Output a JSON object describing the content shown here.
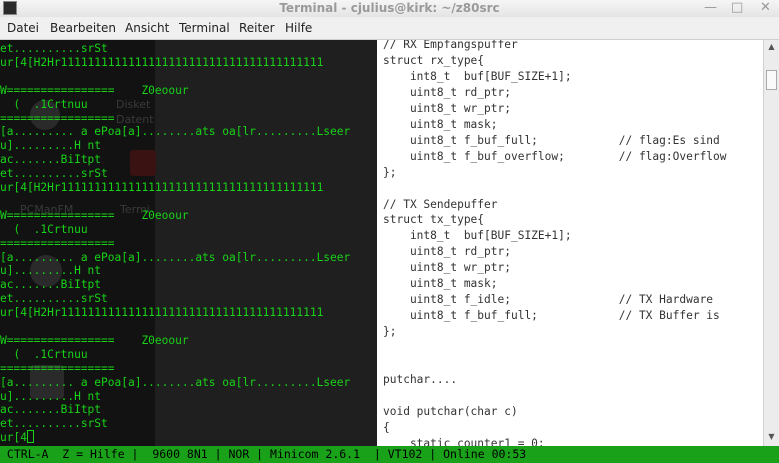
{
  "window": {
    "title": "Terminal - cjulius@kirk: ~/z80src",
    "icon": "terminal-icon"
  },
  "menu": [
    "Datei",
    "Bearbeiten",
    "Ansicht",
    "Terminal",
    "Reiter",
    "Hilfe"
  ],
  "desktop_icons": [
    "Disket",
    "Datent",
    "PCManFM",
    "Termi"
  ],
  "terminal_lines": [
    "et..........srSt",
    "ur[4[H2Hr111111111111111111111111111111111111111",
    "",
    "W================    Z0eoour",
    "  (  .1Crtnuu",
    "=================",
    "[a......... a ePoa[a]........ats oa[lr.........Lseer",
    "u].........H nt",
    "ac.......BiItpt",
    "et..........srSt",
    "ur[4[H2Hr111111111111111111111111111111111111111",
    "",
    "W================    Z0eoour",
    "  (  .1Crtnuu",
    "=================",
    "[a......... a ePoa[a]........ats oa[lr.........Lseer",
    "u].........H nt",
    "ac.......BiItpt",
    "et..........srSt",
    "ur[4[H2Hr111111111111111111111111111111111111111",
    "",
    "W================    Z0eoour",
    "  (  .1Crtnuu",
    "=================",
    "[a......... a ePoa[a]........ats oa[lr.........Lseer",
    "u].........H nt",
    "ac.......BiItpt",
    "et..........srSt",
    "ur[4"
  ],
  "editor_lines": [
    "// RX Empfangspuffer",
    "struct rx_type{",
    "    int8_t  buf[BUF_SIZE+1];",
    "    uint8_t rd_ptr;",
    "    uint8_t wr_ptr;",
    "    uint8_t mask;",
    "    uint8_t f_buf_full;            // flag:Es sind",
    "    uint8_t f_buf_overflow;        // flag:Overflow",
    "};",
    "",
    "// TX Sendepuffer",
    "struct tx_type{",
    "    int8_t  buf[BUF_SIZE+1];",
    "    uint8_t rd_ptr;",
    "    uint8_t wr_ptr;",
    "    uint8_t mask;",
    "    uint8_t f_idle;                // TX Hardware",
    "    uint8_t f_buf_full;            // TX Buffer is",
    "};",
    "",
    "",
    "putchar....",
    "",
    "void putchar(char c)",
    "{",
    "    static counter1 = 0;"
  ],
  "status_bar": " CTRL-A  Z = Hilfe |  9600 8N1 | NOR | Minicom 2.6.1  | VT102 | Online 00:53",
  "colors": {
    "terminal_green": "#18d318",
    "status_green": "#1aa11a"
  }
}
